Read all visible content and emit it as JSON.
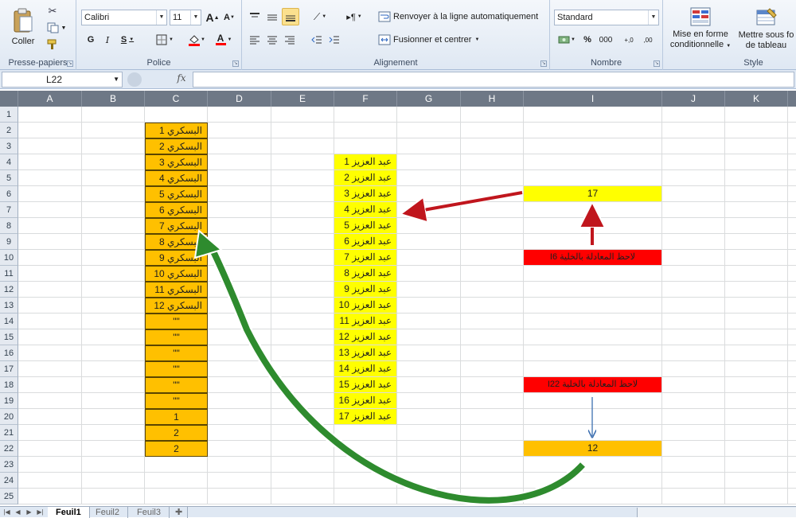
{
  "ribbon": {
    "clipboard": {
      "label": "Presse-papiers",
      "paste_label": "Coller"
    },
    "font": {
      "label": "Police",
      "font_name": "Calibri",
      "font_size": "11",
      "grow_label": "A",
      "shrink_label": "A",
      "bold": "G",
      "italic": "I",
      "underline": "S",
      "color_letter": "A"
    },
    "alignment": {
      "label": "Alignement",
      "wrap_text": "Renvoyer à la ligne automatiquement",
      "merge_center": "Fusionner et centrer"
    },
    "number": {
      "label": "Nombre",
      "format": "Standard",
      "percent": "%",
      "thousands": "000",
      "inc_decimal": "+,0",
      "dec_decimal": ",00"
    },
    "styles": {
      "label": "Style",
      "conditional_1": "Mise en forme",
      "conditional_2": "conditionnelle",
      "table_1": "Mettre sous fo",
      "table_2": "de tableau"
    }
  },
  "formula_bar": {
    "name_box": "L22",
    "fx": "fx",
    "value": ""
  },
  "grid": {
    "columns": [
      {
        "name": "A",
        "width": 80
      },
      {
        "name": "B",
        "width": 79
      },
      {
        "name": "C",
        "width": 79
      },
      {
        "name": "D",
        "width": 80
      },
      {
        "name": "E",
        "width": 79
      },
      {
        "name": "F",
        "width": 79
      },
      {
        "name": "G",
        "width": 80
      },
      {
        "name": "H",
        "width": 79
      },
      {
        "name": "I",
        "width": 174
      },
      {
        "name": "J",
        "width": 79
      },
      {
        "name": "K",
        "width": 79
      },
      {
        "name": "L",
        "width": 30
      }
    ],
    "rows": [
      "1",
      "2",
      "3",
      "4",
      "5",
      "6",
      "7",
      "8",
      "9",
      "10",
      "11",
      "12",
      "13",
      "14",
      "15",
      "16",
      "17",
      "18",
      "19",
      "20",
      "21",
      "22",
      "23",
      "24",
      "25"
    ],
    "column_c": [
      "البسكري 1",
      "البسكري 2",
      "البسكري 3",
      "البسكري 4",
      "البسكري 5",
      "البسكري 6",
      "البسكري 7",
      "البسكري 8",
      "البسكري 9",
      "البسكري 10",
      "البسكري 11",
      "البسكري 12",
      "\"\"",
      "\"\"",
      "\"\"",
      "\"\"",
      "\"\"",
      "\"\"",
      "1",
      "2",
      "2"
    ],
    "column_f": [
      "عبد العزيز 1",
      "عبد العزيز 2",
      "عبد العزيز 3",
      "عبد العزيز 4",
      "عبد العزيز 5",
      "عبد العزيز 6",
      "عبد العزيز 7",
      "عبد العزيز 8",
      "عبد العزيز 9",
      "عبد العزيز 10",
      "عبد العزيز 11",
      "عبد العزيز 12",
      "عبد العزيز 13",
      "عبد العزيز 14",
      "عبد العزيز 15",
      "عبد العزيز 16",
      "عبد العزيز 17"
    ],
    "i6": "17",
    "i10": "لاحظ المعادلة بالخلية I6",
    "i18": "لاحظ المعادلة بالخلية I22",
    "i22": "12"
  },
  "colors": {
    "orange": "#ffc000",
    "yellow": "#ffff00",
    "red": "#ff0000",
    "green_arrow": "#2e8b2e",
    "red_arrow": "#c0161d"
  },
  "sheets": [
    {
      "name": "Feuil1",
      "active": true
    },
    {
      "name": "Feuil2"
    },
    {
      "name": "Feuil3"
    }
  ]
}
